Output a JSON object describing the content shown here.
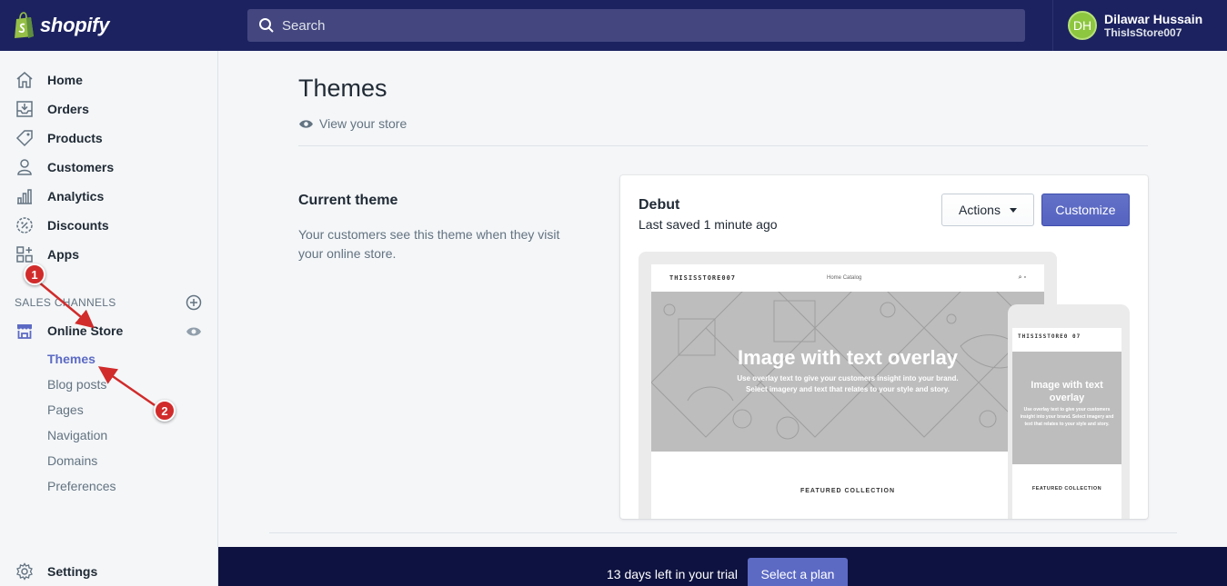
{
  "brand": {
    "name": "shopify",
    "accent": "#5c6ac4",
    "topbar_color": "#1c2260"
  },
  "search": {
    "placeholder": "Search"
  },
  "user": {
    "initials": "DH",
    "name": "Dilawar Hussain",
    "store": "ThisIsStore007"
  },
  "sidebar": {
    "items": [
      {
        "label": "Home",
        "icon": "home-icon"
      },
      {
        "label": "Orders",
        "icon": "orders-icon"
      },
      {
        "label": "Products",
        "icon": "tag-icon"
      },
      {
        "label": "Customers",
        "icon": "person-icon"
      },
      {
        "label": "Analytics",
        "icon": "bar-chart-icon"
      },
      {
        "label": "Discounts",
        "icon": "discount-icon"
      },
      {
        "label": "Apps",
        "icon": "apps-icon"
      }
    ],
    "sales_channels_label": "SALES CHANNELS",
    "online_store": "Online Store",
    "sub_items": [
      "Themes",
      "Blog posts",
      "Pages",
      "Navigation",
      "Domains",
      "Preferences"
    ],
    "active_sub": "Themes",
    "settings": "Settings"
  },
  "main": {
    "title": "Themes",
    "view_store": "View your store",
    "current_theme_heading": "Current theme",
    "current_theme_desc": "Your customers see this theme when they visit your online store."
  },
  "theme_card": {
    "name": "Debut",
    "saved": "Last saved 1 minute ago",
    "actions_label": "Actions",
    "customize_label": "Customize",
    "preview": {
      "store_name": "THISISSTORE007",
      "mobile_store_name": "THISISSTORE0 07",
      "nav": "Home    Catalog",
      "hero_title": "Image with text overlay",
      "hero_sub_1": "Use overlay text to give your customers insight into your brand.",
      "hero_sub_2": "Select imagery and text that relates to your style and story.",
      "mobile_hero_title": "Image with text overlay",
      "mobile_hero_sub": "Use overlay text to give your customers insight into your brand. Select imagery and text that relates to your style and story.",
      "featured": "FEATURED COLLECTION"
    }
  },
  "trial": {
    "text": "13 days left in your trial",
    "button": "Select a plan"
  },
  "annotations": {
    "marker_1": "1",
    "marker_2": "2",
    "color": "#d12b2b"
  }
}
